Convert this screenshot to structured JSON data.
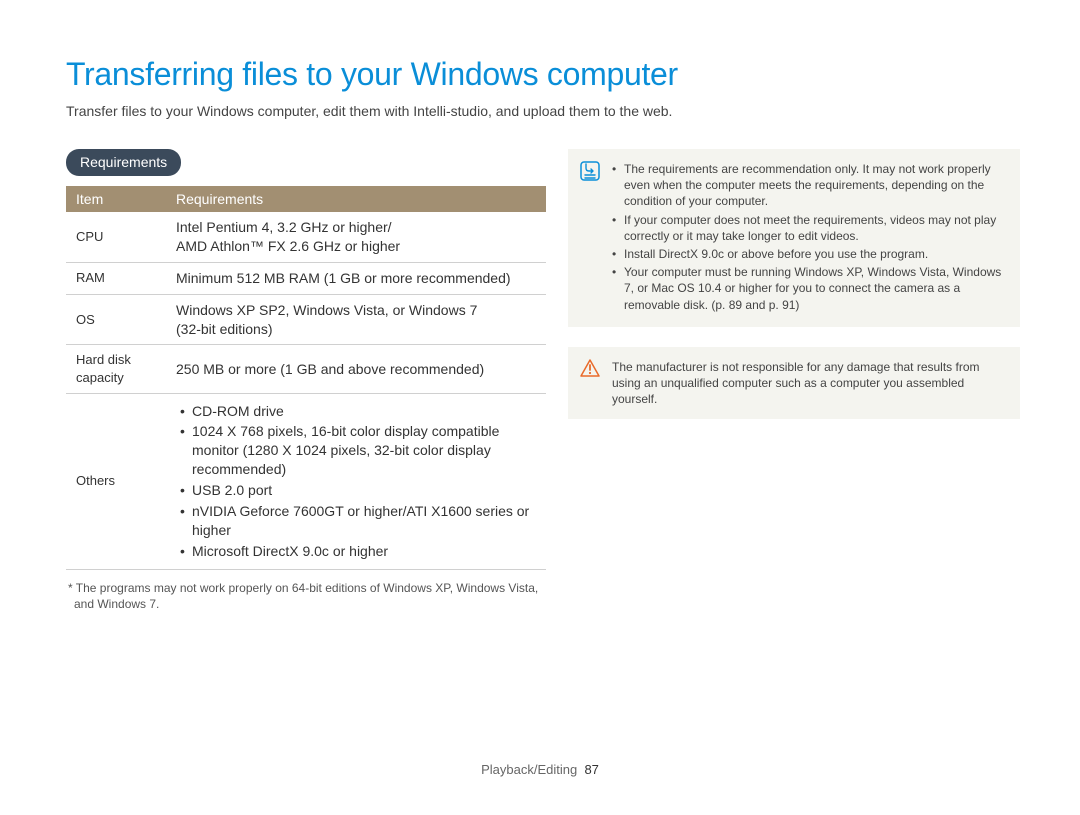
{
  "title": "Transferring files to your Windows computer",
  "intro": "Transfer files to your Windows computer, edit them with Intelli-studio, and upload them to the web.",
  "requirements_label": "Requirements",
  "table": {
    "head_item": "Item",
    "head_req": "Requirements",
    "rows": [
      {
        "item": "CPU",
        "req": "Intel Pentium 4, 3.2 GHz or higher/\nAMD Athlon™ FX 2.6 GHz or higher"
      },
      {
        "item": "RAM",
        "req": "Minimum 512 MB RAM (1 GB or more recommended)"
      },
      {
        "item": "OS",
        "req": "Windows XP SP2, Windows Vista, or Windows 7\n(32-bit editions)"
      },
      {
        "item": "Hard disk\ncapacity",
        "req": "250 MB or more (1 GB and above recommended)"
      }
    ],
    "others_label": "Others",
    "others_items": [
      "CD-ROM drive",
      "1024 X 768 pixels, 16-bit color display compatible monitor (1280 X 1024 pixels, 32-bit color display recommended)",
      "USB 2.0 port",
      "nVIDIA Geforce 7600GT or higher/ATI X1600 series or higher",
      "Microsoft DirectX 9.0c or higher"
    ]
  },
  "asterisk_note": "* The programs may not work properly on 64-bit editions of Windows XP, Windows Vista, and Windows 7.",
  "note_items": [
    "The requirements are recommendation only. It may not work properly even when the computer meets the requirements, depending on the condition of your computer.",
    "If your computer does not meet the requirements, videos may not play correctly or it may take longer to edit videos.",
    "Install DirectX 9.0c or above before you use the program.",
    "Your computer must be running Windows XP, Windows Vista, Windows 7, or Mac OS 10.4 or higher for you to connect the camera as a removable disk. (p. 89 and p. 91)"
  ],
  "warn_text": "The manufacturer is not responsible for any damage that results from using an unqualified computer such as a computer you assembled yourself.",
  "footer_section": "Playback/Editing",
  "footer_page": "87"
}
